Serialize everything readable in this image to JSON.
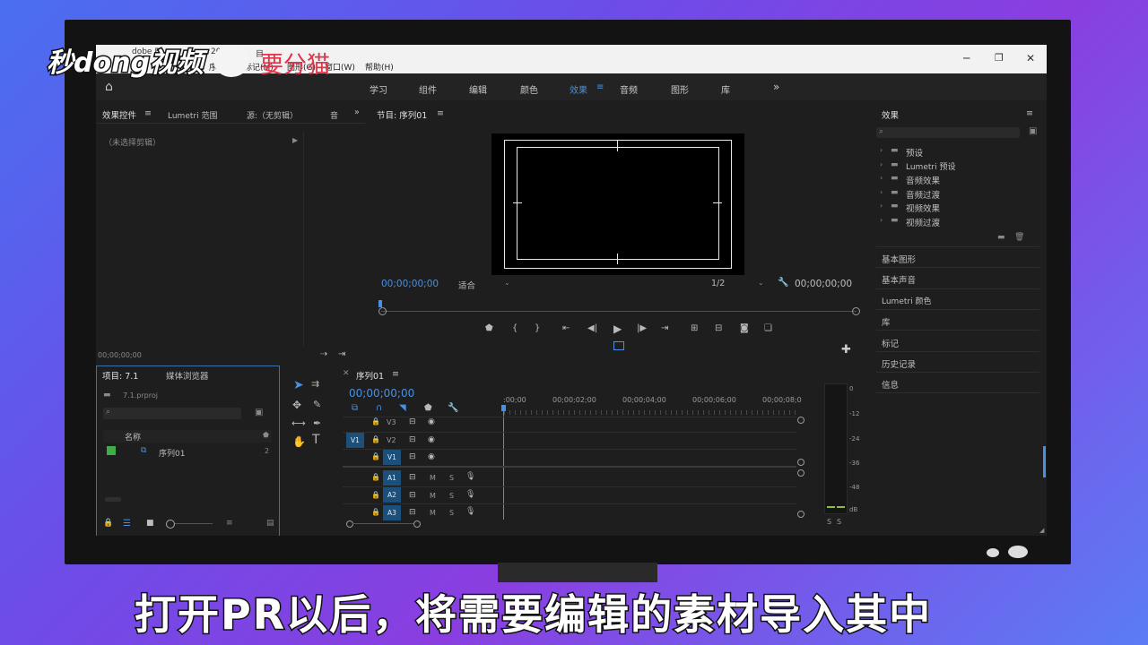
{
  "watermark": {
    "brand": "秒dong视频",
    "partner": "要分猫"
  },
  "titlebar": {
    "app": "dobe Pr",
    "year": "2019",
    "project_fragment": "目"
  },
  "menu": [
    "序列",
    "标记(M)",
    "图形(G)",
    "窗口(W)",
    "帮助(H)"
  ],
  "workspaces": [
    "学习",
    "组件",
    "编辑",
    "颜色",
    "效果",
    "音频",
    "图形",
    "库"
  ],
  "workspace_active": "效果",
  "workspace_more": "»",
  "effect_controls": {
    "tabs": [
      "效果控件",
      "Lumetri 范围",
      "源:（无剪辑）",
      "音"
    ],
    "no_clip": "（未选择剪辑）",
    "timecode": "00;00;00;00"
  },
  "program": {
    "tab": "节目: 序列01",
    "timecode_left": "00;00;00;00",
    "fit": "适合",
    "resolution": "1/2",
    "timecode_right": "00;00;00;00"
  },
  "project": {
    "tabs": [
      "项目: 7.1",
      "媒体浏览器"
    ],
    "filename": "7.1.prproj",
    "column_name": "名称",
    "items": [
      {
        "name": "序列01",
        "count": "2",
        "color": "#3fae49"
      }
    ]
  },
  "timeline": {
    "tab": "序列01",
    "timecode": "00;00;00;00",
    "ruler": [
      ":00;00",
      "00;00;02;00",
      "00;00;04;00",
      "00;00;06;00",
      "00;00;08;0"
    ],
    "video_tracks": [
      "V3",
      "V2",
      "V1"
    ],
    "source_patch": "V1",
    "audio_tracks": [
      "A1",
      "A2",
      "A3"
    ],
    "m": "M",
    "s": "S"
  },
  "meter": {
    "scale": [
      "0",
      "-12",
      "-24",
      "-36",
      "-48",
      "dB"
    ],
    "solo": [
      "S",
      "S"
    ]
  },
  "effects_panel": {
    "title": "效果",
    "folders": [
      "预设",
      "Lumetri 预设",
      "音频效果",
      "音频过渡",
      "视频效果",
      "视频过渡"
    ],
    "sections": [
      "基本图形",
      "基本声音",
      "Lumetri 颜色",
      "库",
      "标记",
      "历史记录",
      "信息"
    ]
  },
  "subtitle": "打开PR以后，将需要编辑的素材导入其中"
}
